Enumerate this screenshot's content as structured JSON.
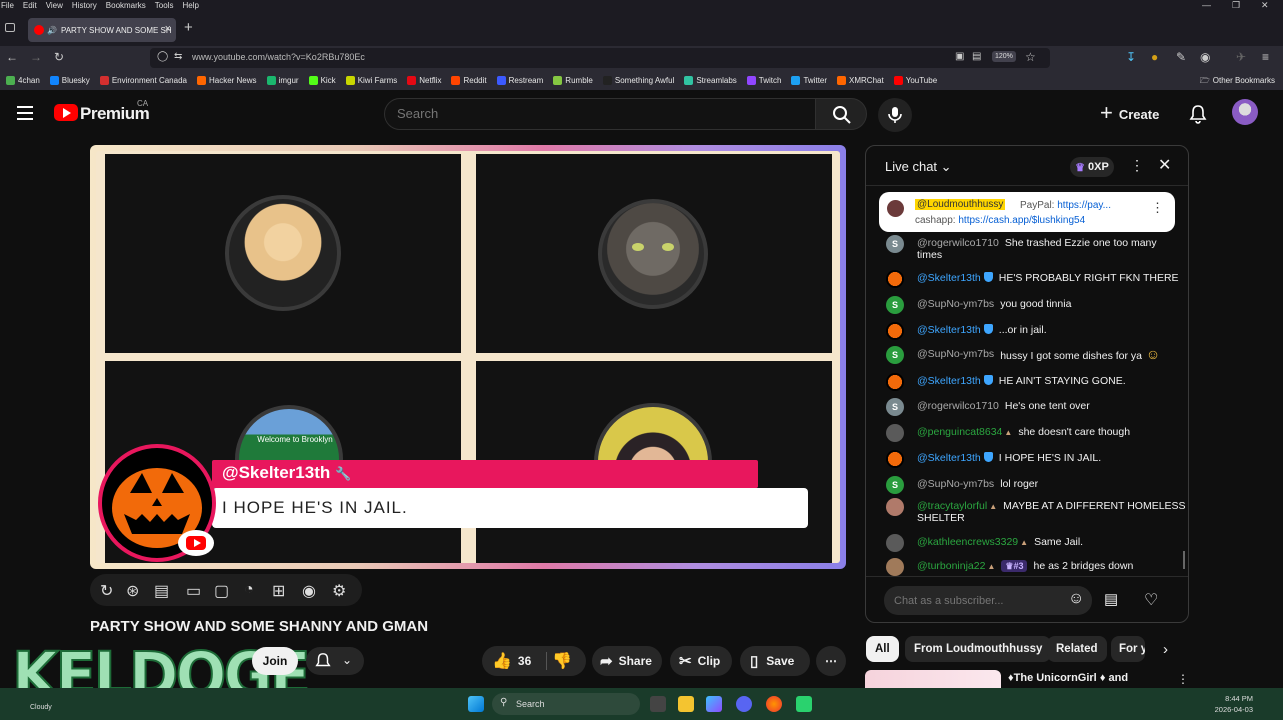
{
  "browser": {
    "menu": [
      "File",
      "Edit",
      "View",
      "History",
      "Bookmarks",
      "Tools",
      "Help"
    ],
    "tab_title": "PARTY SHOW AND SOME SH",
    "url": "www.youtube.com/watch?v=Ko2RBu780Ec",
    "zoom": "120%",
    "bookmarks": [
      {
        "label": "4chan",
        "color": "#4caf50"
      },
      {
        "label": "Bluesky",
        "color": "#1185fe"
      },
      {
        "label": "Environment Canada",
        "color": "#d32f2f"
      },
      {
        "label": "Hacker News",
        "color": "#ff6600"
      },
      {
        "label": "imgur",
        "color": "#1bb76e"
      },
      {
        "label": "Kick",
        "color": "#53fc18"
      },
      {
        "label": "Kiwi Farms",
        "color": "#c8d600"
      },
      {
        "label": "Netflix",
        "color": "#e50914"
      },
      {
        "label": "Reddit",
        "color": "#ff4500"
      },
      {
        "label": "Restream",
        "color": "#3c5aff"
      },
      {
        "label": "Rumble",
        "color": "#85c742"
      },
      {
        "label": "Something Awful",
        "color": "#222222"
      },
      {
        "label": "Streamlabs",
        "color": "#31c3a2"
      },
      {
        "label": "Twitch",
        "color": "#9146ff"
      },
      {
        "label": "Twitter",
        "color": "#1da1f2"
      },
      {
        "label": "XMRChat",
        "color": "#ff6600"
      },
      {
        "label": "YouTube",
        "color": "#ff0000"
      }
    ],
    "other_bookmarks": "Other Bookmarks"
  },
  "youtube": {
    "brand": "Premium",
    "country": "CA",
    "search_placeholder": "Search",
    "create_label": "Create"
  },
  "stream": {
    "lower_third_name": "@Skelter13th",
    "lower_third_message": "I HOPE HE'S IN JAIL.",
    "welcome_sign": "Welcome to Brooklyn"
  },
  "video": {
    "title": "PARTY SHOW AND SOME SHANNY AND GMAN",
    "join_label": "Join",
    "likes": "36",
    "share_label": "Share",
    "clip_label": "Clip",
    "save_label": "Save",
    "overlay_watermark": "KELDOGE"
  },
  "chat": {
    "title": "Live chat",
    "xp": "0XP",
    "pinned_user": "@Loudmouthhussy",
    "pinned_text1": "PayPal: ",
    "pinned_link1": "https://pay...",
    "pinned_text2": "cashapp: ",
    "pinned_link2": "https://cash.app/$lushking54",
    "messages": [
      {
        "user": "@rogerwilco1710",
        "text": "She trashed Ezzie one too many",
        "text2": "times",
        "kind": "gray"
      },
      {
        "user": "@Skelter13th",
        "text": "HE'S PROBABLY RIGHT FKN THERE",
        "kind": "mod"
      },
      {
        "user": "@SupNo-ym7bs",
        "text": "you good tinnia",
        "kind": "s"
      },
      {
        "user": "@Skelter13th",
        "text": "...or in jail.",
        "kind": "mod"
      },
      {
        "user": "@SupNo-ym7bs",
        "text": "hussy I got some dishes for ya",
        "kind": "s"
      },
      {
        "user": "@Skelter13th",
        "text": "HE AIN'T STAYING GONE.",
        "kind": "mod"
      },
      {
        "user": "@rogerwilco1710",
        "text": "He's one tent over",
        "kind": "gray"
      },
      {
        "user": "@penguincat8634",
        "text": "she doesn't care though",
        "kind": "member"
      },
      {
        "user": "@Skelter13th",
        "text": "I HOPE HE'S IN JAIL.",
        "kind": "mod"
      },
      {
        "user": "@SupNo-ym7bs",
        "text": "lol roger",
        "kind": "s"
      },
      {
        "user": "@tracytaylorful",
        "text": "MAYBE AT A DIFFERENT HOMELESS",
        "text2": "SHELTER",
        "kind": "member"
      },
      {
        "user": "@kathleencrews3329",
        "text": "Same Jail.",
        "kind": "member"
      },
      {
        "user": "@turboninja22",
        "badge": "#3",
        "text": "he as 2 bridges down",
        "kind": "member"
      }
    ],
    "input_placeholder": "Chat as a subscriber..."
  },
  "chips": [
    "All",
    "From Loudmouthhussy",
    "Related",
    "For y"
  ],
  "recommendation_title": "The UnicornGirl",
  "recommendation_and": "and",
  "taskbar": {
    "weather": "Cloudy",
    "search_label": "Search",
    "time": "8:44 PM",
    "date": "2026-04-03"
  }
}
